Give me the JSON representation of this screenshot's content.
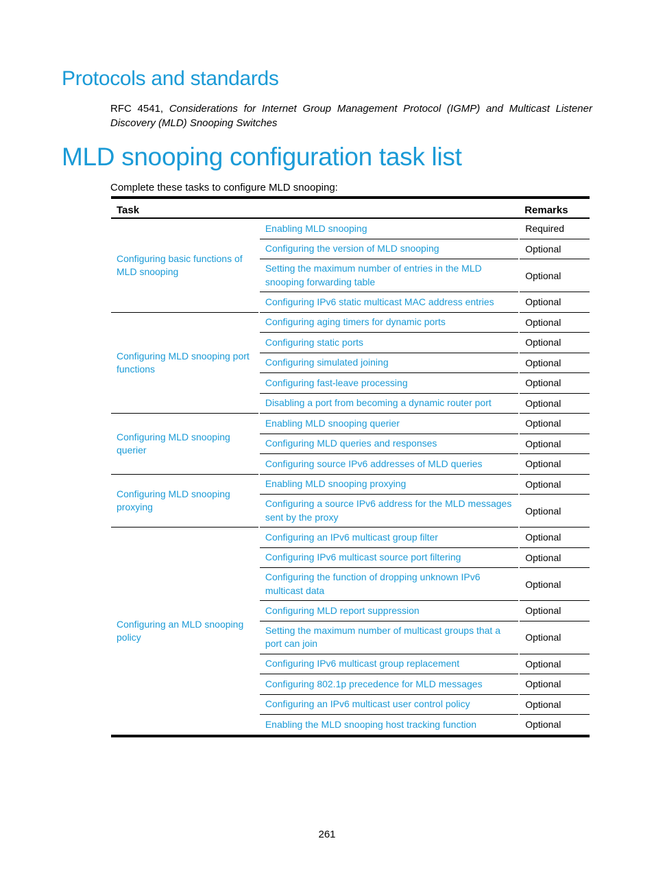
{
  "section1": {
    "title": "Protocols and standards",
    "reference_plain": "RFC 4541, ",
    "reference_italic": "Considerations for Internet Group Management Protocol (IGMP) and Multicast Listener Discovery (MLD) Snooping Switches"
  },
  "section2": {
    "title": "MLD snooping configuration task list",
    "intro": "Complete these tasks to configure MLD snooping:"
  },
  "table": {
    "headers": {
      "task": "Task",
      "remarks": "Remarks"
    },
    "groups": [
      {
        "label": "Configuring basic functions of MLD snooping",
        "rows": [
          {
            "task": "Enabling MLD snooping",
            "remark": "Required"
          },
          {
            "task": "Configuring the version of MLD snooping",
            "remark": "Optional"
          },
          {
            "task": "Setting the maximum number of entries in the MLD snooping forwarding table",
            "remark": "Optional"
          },
          {
            "task": "Configuring IPv6 static multicast MAC address entries",
            "remark": "Optional"
          }
        ]
      },
      {
        "label": "Configuring MLD snooping port functions",
        "rows": [
          {
            "task": "Configuring aging timers for dynamic ports",
            "remark": "Optional"
          },
          {
            "task": "Configuring static ports",
            "remark": "Optional"
          },
          {
            "task": "Configuring simulated joining",
            "remark": "Optional"
          },
          {
            "task": "Configuring fast-leave processing",
            "remark": "Optional"
          },
          {
            "task": "Disabling a port from becoming a dynamic router port",
            "remark": "Optional"
          }
        ]
      },
      {
        "label": "Configuring MLD snooping querier",
        "rows": [
          {
            "task": "Enabling MLD snooping querier",
            "remark": "Optional"
          },
          {
            "task": "Configuring MLD queries and responses",
            "remark": "Optional"
          },
          {
            "task": "Configuring source IPv6 addresses of MLD queries",
            "remark": "Optional"
          }
        ]
      },
      {
        "label": "Configuring MLD snooping proxying",
        "rows": [
          {
            "task": "Enabling MLD snooping proxying",
            "remark": "Optional"
          },
          {
            "task": "Configuring a source IPv6 address for the MLD messages sent by the proxy",
            "remark": "Optional"
          }
        ]
      },
      {
        "label": "Configuring an MLD snooping policy",
        "rows": [
          {
            "task": "Configuring an IPv6 multicast group filter",
            "remark": "Optional"
          },
          {
            "task": "Configuring IPv6 multicast source port filtering",
            "remark": "Optional"
          },
          {
            "task": "Configuring the function of dropping unknown IPv6 multicast data",
            "remark": "Optional"
          },
          {
            "task": "Configuring MLD report suppression",
            "remark": "Optional"
          },
          {
            "task": "Setting the maximum number of multicast groups that a port can join",
            "remark": "Optional"
          },
          {
            "task": "Configuring IPv6 multicast group replacement",
            "remark": "Optional"
          },
          {
            "task": "Configuring 802.1p precedence for MLD messages",
            "remark": "Optional"
          },
          {
            "task": "Configuring an IPv6 multicast user control policy",
            "remark": "Optional"
          },
          {
            "task": "Enabling the MLD snooping host tracking function",
            "remark": "Optional"
          }
        ]
      }
    ]
  },
  "page_number": "261",
  "colors": {
    "link": "#1a9ad6",
    "heading": "#1a9ad6",
    "text": "#000000"
  }
}
